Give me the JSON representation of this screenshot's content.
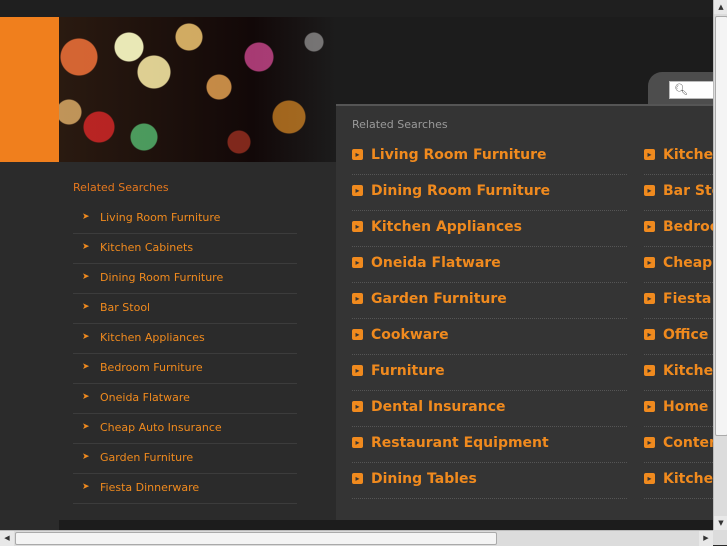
{
  "search": {
    "placeholder": ""
  },
  "sidebar": {
    "title": "Related Searches",
    "items": [
      "Living Room Furniture",
      "Kitchen Cabinets",
      "Dining Room Furniture",
      "Bar Stool",
      "Kitchen Appliances",
      "Bedroom Furniture",
      "Oneida Flatware",
      "Cheap Auto Insurance",
      "Garden Furniture",
      "Fiesta Dinnerware"
    ]
  },
  "panel": {
    "title": "Related Searches",
    "col1": [
      "Living Room Furniture",
      "Dining Room Furniture",
      "Kitchen Appliances",
      "Oneida Flatware",
      "Garden Furniture",
      "Cookware",
      "Furniture",
      "Dental Insurance",
      "Restaurant Equipment",
      "Dining Tables"
    ],
    "col2": [
      "Kitchen",
      "Bar Sto",
      "Bedroo",
      "Cheap",
      "Fiesta D",
      "Office F",
      "Kitchen",
      "Home D",
      "Conten",
      "Kitchen"
    ]
  },
  "icons": {
    "list_arrow": "arrow-right-icon",
    "bullet": "orange-arrow-bullet-icon",
    "search": "magnifier-icon"
  },
  "colors": {
    "accent": "#f08a1e",
    "background": "#2b2b2b",
    "panel": "#343434"
  }
}
